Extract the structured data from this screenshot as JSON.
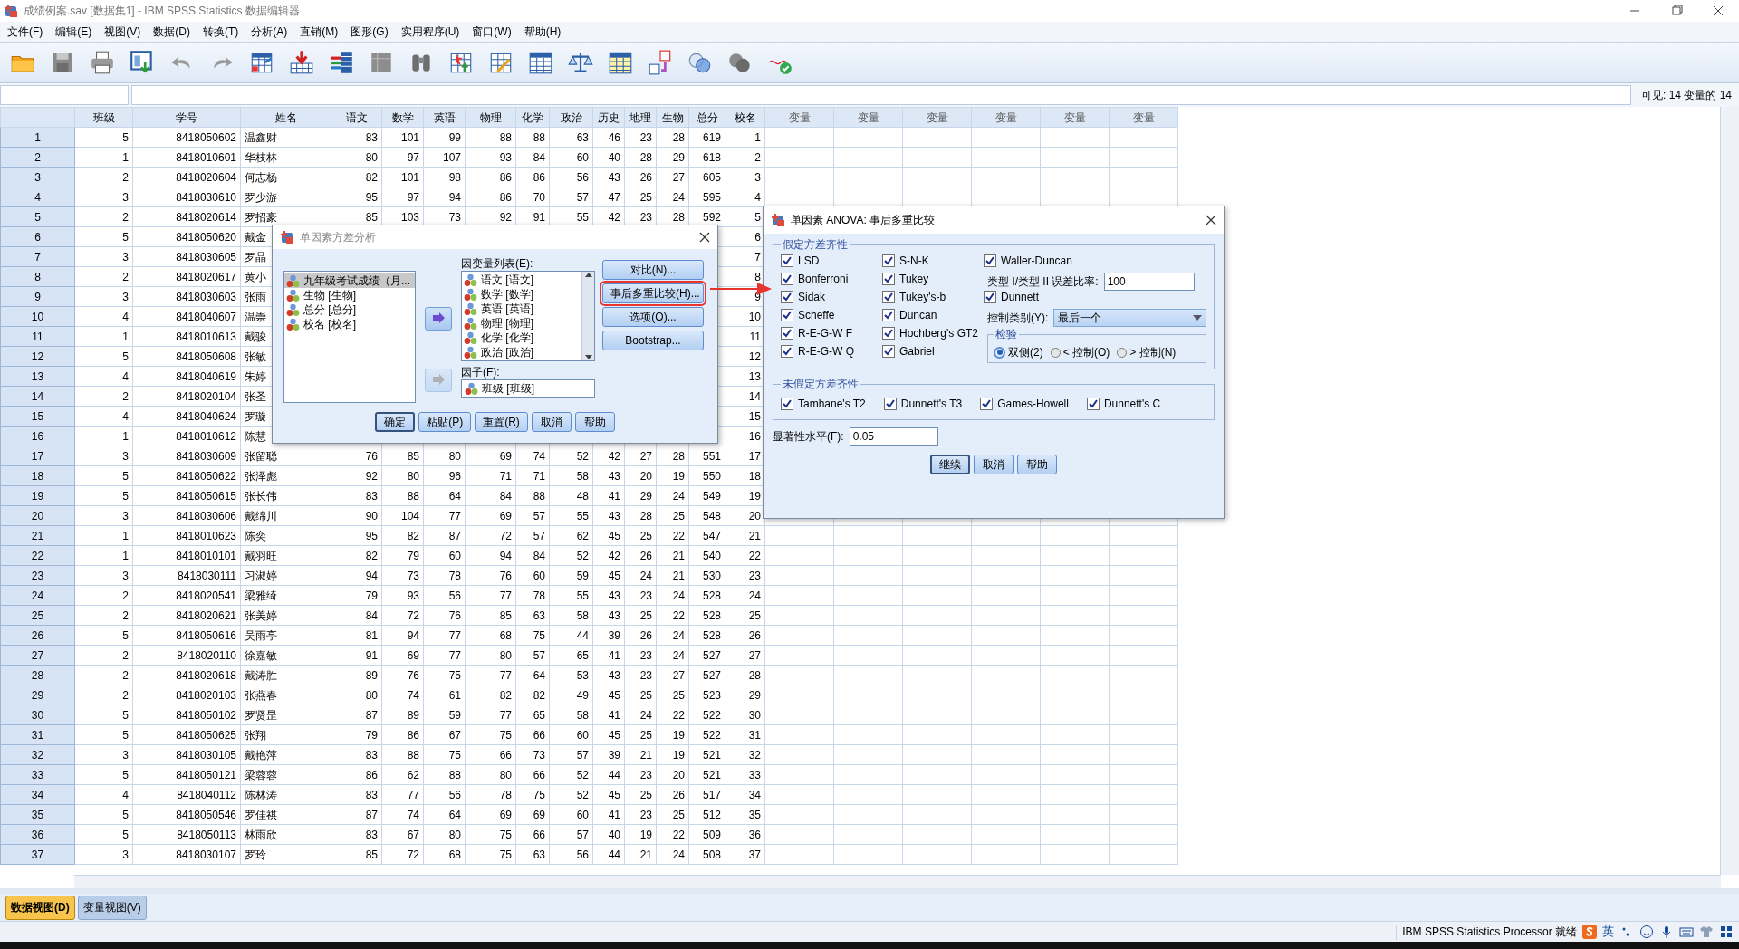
{
  "window": {
    "title": "成绩例案.sav [数据集1] - IBM SPSS Statistics 数据编辑器"
  },
  "menu": [
    "文件(F)",
    "编辑(E)",
    "视图(V)",
    "数据(D)",
    "转换(T)",
    "分析(A)",
    "直销(M)",
    "图形(G)",
    "实用程序(U)",
    "窗口(W)",
    "帮助(H)"
  ],
  "formula_bar": {
    "visible_count": "可见: 14 变量的 14"
  },
  "table": {
    "columns": [
      "班级",
      "学号",
      "姓名",
      "语文",
      "数学",
      "英语",
      "物理",
      "化学",
      "政治",
      "历史",
      "地理",
      "生物",
      "总分",
      "校名",
      "变量",
      "变量",
      "变量",
      "变量",
      "变量",
      "变量"
    ],
    "rows": [
      {
        "row": "1",
        "cells": [
          "5",
          "8418050602",
          "温鑫财",
          "83",
          "101",
          "99",
          "88",
          "88",
          "63",
          "46",
          "23",
          "28",
          "619",
          "1"
        ]
      },
      {
        "row": "2",
        "cells": [
          "1",
          "8418010601",
          "华枝林",
          "80",
          "97",
          "107",
          "93",
          "84",
          "60",
          "40",
          "28",
          "29",
          "618",
          "2"
        ]
      },
      {
        "row": "3",
        "cells": [
          "2",
          "8418020604",
          "何志杨",
          "82",
          "101",
          "98",
          "86",
          "86",
          "56",
          "43",
          "26",
          "27",
          "605",
          "3"
        ]
      },
      {
        "row": "4",
        "cells": [
          "3",
          "8418030610",
          "罗少游",
          "95",
          "97",
          "94",
          "86",
          "70",
          "57",
          "47",
          "25",
          "24",
          "595",
          "4"
        ]
      },
      {
        "row": "5",
        "cells": [
          "2",
          "8418020614",
          "罗招豪",
          "85",
          "103",
          "73",
          "92",
          "91",
          "55",
          "42",
          "23",
          "28",
          "592",
          "5"
        ]
      },
      {
        "row": "6",
        "cells": [
          "5",
          "8418050620",
          "戴金",
          null,
          null,
          null,
          null,
          null,
          null,
          null,
          null,
          null,
          null,
          "6"
        ]
      },
      {
        "row": "7",
        "cells": [
          "3",
          "8418030605",
          "罗晶",
          null,
          null,
          null,
          null,
          null,
          null,
          null,
          null,
          null,
          null,
          "7"
        ]
      },
      {
        "row": "8",
        "cells": [
          "2",
          "8418020617",
          "黄小",
          null,
          null,
          null,
          null,
          null,
          null,
          null,
          null,
          null,
          null,
          "8"
        ]
      },
      {
        "row": "9",
        "cells": [
          "3",
          "8418030603",
          "张雨",
          null,
          null,
          null,
          null,
          null,
          null,
          null,
          null,
          null,
          null,
          "9"
        ]
      },
      {
        "row": "10",
        "cells": [
          "4",
          "8418040607",
          "温崇",
          null,
          null,
          null,
          null,
          null,
          null,
          null,
          null,
          null,
          null,
          "10"
        ]
      },
      {
        "row": "11",
        "cells": [
          "1",
          "8418010613",
          "戴骏",
          null,
          null,
          null,
          null,
          null,
          null,
          null,
          null,
          null,
          null,
          "11"
        ]
      },
      {
        "row": "12",
        "cells": [
          "5",
          "8418050608",
          "张敏",
          null,
          null,
          null,
          null,
          null,
          null,
          null,
          null,
          null,
          null,
          "12"
        ]
      },
      {
        "row": "13",
        "cells": [
          "4",
          "8418040619",
          "朱婷",
          null,
          null,
          null,
          null,
          null,
          null,
          null,
          null,
          null,
          null,
          "13"
        ]
      },
      {
        "row": "14",
        "cells": [
          "2",
          "8418020104",
          "张圣",
          null,
          null,
          null,
          null,
          null,
          null,
          null,
          null,
          null,
          null,
          "14"
        ]
      },
      {
        "row": "15",
        "cells": [
          "4",
          "8418040624",
          "罗璇",
          null,
          null,
          null,
          null,
          null,
          null,
          null,
          null,
          null,
          null,
          "15"
        ]
      },
      {
        "row": "16",
        "cells": [
          "1",
          "8418010612",
          "陈慧",
          null,
          null,
          null,
          null,
          null,
          null,
          null,
          null,
          null,
          null,
          "16"
        ]
      },
      {
        "row": "17",
        "cells": [
          "3",
          "8418030609",
          "张留聪",
          "76",
          "85",
          "80",
          "69",
          "74",
          "52",
          "42",
          "27",
          "28",
          "551",
          "17"
        ]
      },
      {
        "row": "18",
        "cells": [
          "5",
          "8418050622",
          "张泽彪",
          "92",
          "80",
          "96",
          "71",
          "71",
          "58",
          "43",
          "20",
          "19",
          "550",
          "18"
        ]
      },
      {
        "row": "19",
        "cells": [
          "5",
          "8418050615",
          "张长伟",
          "83",
          "88",
          "64",
          "84",
          "88",
          "48",
          "41",
          "29",
          "24",
          "549",
          "19"
        ]
      },
      {
        "row": "20",
        "cells": [
          "3",
          "8418030606",
          "戴绵川",
          "90",
          "104",
          "77",
          "69",
          "57",
          "55",
          "43",
          "28",
          "25",
          "548",
          "20"
        ]
      },
      {
        "row": "21",
        "cells": [
          "1",
          "8418010623",
          "陈奕",
          "95",
          "82",
          "87",
          "72",
          "57",
          "62",
          "45",
          "25",
          "22",
          "547",
          "21"
        ]
      },
      {
        "row": "22",
        "cells": [
          "1",
          "8418010101",
          "戴羽旺",
          "82",
          "79",
          "60",
          "94",
          "84",
          "52",
          "42",
          "26",
          "21",
          "540",
          "22"
        ]
      },
      {
        "row": "23",
        "cells": [
          "3",
          "8418030111",
          "习淑婷",
          "94",
          "73",
          "78",
          "76",
          "60",
          "59",
          "45",
          "24",
          "21",
          "530",
          "23"
        ]
      },
      {
        "row": "24",
        "cells": [
          "2",
          "8418020541",
          "梁雅绮",
          "79",
          "93",
          "56",
          "77",
          "78",
          "55",
          "43",
          "23",
          "24",
          "528",
          "24"
        ]
      },
      {
        "row": "25",
        "cells": [
          "2",
          "8418020621",
          "张美婷",
          "84",
          "72",
          "76",
          "85",
          "63",
          "58",
          "43",
          "25",
          "22",
          "528",
          "25"
        ]
      },
      {
        "row": "26",
        "cells": [
          "5",
          "8418050616",
          "吴雨亭",
          "81",
          "94",
          "77",
          "68",
          "75",
          "44",
          "39",
          "26",
          "24",
          "528",
          "26"
        ]
      },
      {
        "row": "27",
        "cells": [
          "2",
          "8418020110",
          "徐嘉敏",
          "91",
          "69",
          "77",
          "80",
          "57",
          "65",
          "41",
          "23",
          "24",
          "527",
          "27"
        ]
      },
      {
        "row": "28",
        "cells": [
          "2",
          "8418020618",
          "戴涛胜",
          "89",
          "76",
          "75",
          "77",
          "64",
          "53",
          "43",
          "23",
          "27",
          "527",
          "28"
        ]
      },
      {
        "row": "29",
        "cells": [
          "2",
          "8418020103",
          "张燕春",
          "80",
          "74",
          "61",
          "82",
          "82",
          "49",
          "45",
          "25",
          "25",
          "523",
          "29"
        ]
      },
      {
        "row": "30",
        "cells": [
          "5",
          "8418050102",
          "罗贤昰",
          "87",
          "89",
          "59",
          "77",
          "65",
          "58",
          "41",
          "24",
          "22",
          "522",
          "30"
        ]
      },
      {
        "row": "31",
        "cells": [
          "5",
          "8418050625",
          "张翔",
          "79",
          "86",
          "67",
          "75",
          "66",
          "60",
          "45",
          "25",
          "19",
          "522",
          "31"
        ]
      },
      {
        "row": "32",
        "cells": [
          "3",
          "8418030105",
          "戴艳萍",
          "83",
          "88",
          "75",
          "66",
          "73",
          "57",
          "39",
          "21",
          "19",
          "521",
          "32"
        ]
      },
      {
        "row": "33",
        "cells": [
          "5",
          "8418050121",
          "梁蓉蓉",
          "86",
          "62",
          "88",
          "80",
          "66",
          "52",
          "44",
          "23",
          "20",
          "521",
          "33"
        ]
      },
      {
        "row": "34",
        "cells": [
          "4",
          "8418040112",
          "陈林涛",
          "83",
          "77",
          "56",
          "78",
          "75",
          "52",
          "45",
          "25",
          "26",
          "517",
          "34"
        ]
      },
      {
        "row": "35",
        "cells": [
          "5",
          "8418050546",
          "罗佳祺",
          "87",
          "74",
          "64",
          "69",
          "69",
          "60",
          "41",
          "23",
          "25",
          "512",
          "35"
        ]
      },
      {
        "row": "36",
        "cells": [
          "5",
          "8418050113",
          "林雨欣",
          "83",
          "67",
          "80",
          "75",
          "66",
          "57",
          "40",
          "19",
          "22",
          "509",
          "36"
        ]
      },
      {
        "row": "37",
        "cells": [
          "3",
          "8418030107",
          "罗玲",
          "85",
          "72",
          "68",
          "75",
          "63",
          "56",
          "44",
          "21",
          "24",
          "508",
          "37"
        ]
      }
    ]
  },
  "dialog_oneway": {
    "title": "单因素方差分析",
    "source_list": [
      {
        "label": "九年级考试成绩（月...",
        "selected": true
      },
      {
        "label": "生物 [生物]",
        "selected": false
      },
      {
        "label": "总分 [总分]",
        "selected": false
      },
      {
        "label": "校名 [校名]",
        "selected": false
      }
    ],
    "move_buttons": [
      {
        "disabled": false
      },
      {
        "disabled": true
      }
    ],
    "dependent_label": "因变量列表(E):",
    "dependent_list": [
      "语文 [语文]",
      "数学 [数学]",
      "英语 [英语]",
      "物理 [物理]",
      "化学 [化学]",
      "政治 [政治]"
    ],
    "factor_label": "因子(F):",
    "factor_value": "班级 [班级]",
    "side_buttons": [
      {
        "label": "对比(N)...",
        "highlighted": false
      },
      {
        "label": "事后多重比较(H)...",
        "highlighted": true
      },
      {
        "label": "选项(O)...",
        "highlighted": false
      },
      {
        "label": "Bootstrap...",
        "highlighted": false
      }
    ],
    "buttons": [
      {
        "label": "确定",
        "default": true
      },
      {
        "label": "粘贴(P)",
        "default": false
      },
      {
        "label": "重置(R)",
        "default": false
      },
      {
        "label": "取消",
        "default": false
      },
      {
        "label": "帮助",
        "default": false
      }
    ]
  },
  "dialog_posthoc": {
    "title": "单因素 ANOVA: 事后多重比较",
    "equal_variances": {
      "title": "假定方差齐性",
      "column_1": [
        {
          "label": "LSD",
          "checked": true
        },
        {
          "label": "Bonferroni",
          "checked": true
        },
        {
          "label": "Sidak",
          "checked": true
        },
        {
          "label": "Scheffe",
          "checked": true
        },
        {
          "label": "R-E-G-W F",
          "checked": true
        },
        {
          "label": "R-E-G-W Q",
          "checked": true
        }
      ],
      "column_2": [
        {
          "label": "S-N-K",
          "checked": true
        },
        {
          "label": "Tukey",
          "checked": true
        },
        {
          "label": "Tukey's-b",
          "checked": true
        },
        {
          "label": "Duncan",
          "checked": true
        },
        {
          "label": "Hochberg's GT2",
          "checked": true
        },
        {
          "label": "Gabriel",
          "checked": true
        }
      ],
      "waller_duncan": {
        "label": "Waller-Duncan",
        "checked": true
      },
      "error_ratio": {
        "label": "类型 I/类型 II 误差比率:",
        "value": "100"
      },
      "dunnett": {
        "label": "Dunnett",
        "checked": true
      },
      "control_category": {
        "label": "控制类别(Y):",
        "value": "最后一个"
      },
      "test": {
        "title": "检验",
        "options": [
          {
            "label": "双侧(2)",
            "selected": true
          },
          {
            "label": "< 控制(O)",
            "selected": false
          },
          {
            "label": "> 控制(N)",
            "selected": false
          }
        ]
      }
    },
    "unequal_variances": {
      "title": "未假定方差齐性",
      "options": [
        {
          "label": "Tamhane's T2",
          "checked": true
        },
        {
          "label": "Dunnett's T3",
          "checked": true
        },
        {
          "label": "Games-Howell",
          "checked": true
        },
        {
          "label": "Dunnett's C",
          "checked": true
        }
      ]
    },
    "significance": {
      "label": "显著性水平(F):",
      "value": "0.05"
    },
    "buttons": [
      {
        "label": "继续",
        "default": true
      },
      {
        "label": "取消",
        "default": false
      },
      {
        "label": "帮助",
        "default": false
      }
    ]
  },
  "view_tabs": [
    {
      "label": "数据视图(D)",
      "selected": true
    },
    {
      "label": "变量视图(V)",
      "selected": false
    }
  ],
  "status_bar": {
    "text": "IBM SPSS Statistics Processor 就绪",
    "ime": "英"
  }
}
